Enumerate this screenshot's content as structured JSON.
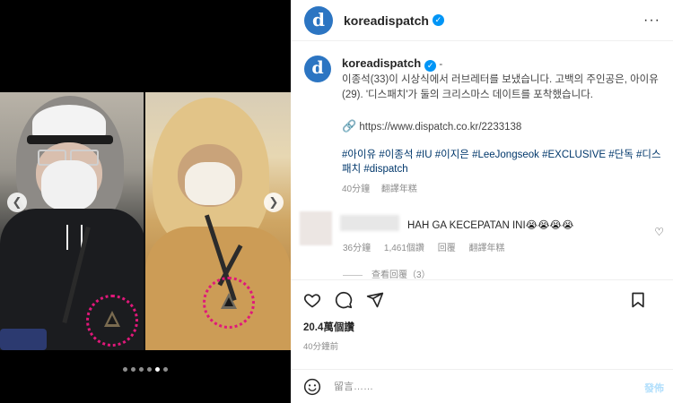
{
  "media": {
    "carousel_total": 6,
    "carousel_active_index": 4,
    "prev_icon": "chevron-left-icon",
    "next_icon": "chevron-right-icon"
  },
  "header": {
    "avatar_letter": "d",
    "username": "koreadispatch",
    "verified_icon": "verified-badge-icon",
    "more_icon": "more-options-icon"
  },
  "caption": {
    "avatar_letter": "d",
    "username": "koreadispatch",
    "separator": " -",
    "text": "이종석(33)이 시상식에서 러브레터를 보냈습니다. 고백의 주인공은, 아이유(29). '디스패치'가 둘의 크리스마스 데이트를 포착했습니다.",
    "link_icon": "link-icon",
    "link_text": "https://www.dispatch.co.kr/2233138",
    "hashtags": "#아이유 #이종석 #IU #이지은 #LeeJongseok #EXCLUSIVE #단독 #디스패치 #dispatch",
    "time": "40分鐘",
    "translate": "翻譯年糕"
  },
  "comment": {
    "text": "HAH GA KECEPATAN INI😭😭😭😭",
    "time": "36分鐘",
    "likes": "1,461個讚",
    "reply": "回覆",
    "translate": "翻譯年糕",
    "view_replies": "查看回覆（3）",
    "heart_icon": "heart-outline-icon"
  },
  "actions": {
    "like_icon": "heart-icon",
    "comment_icon": "comment-icon",
    "share_icon": "send-icon",
    "save_icon": "bookmark-icon",
    "likes": "20.4萬個讚",
    "posted_ago": "40分鐘前"
  },
  "composer": {
    "emoji_icon": "emoji-icon",
    "placeholder": "留言……",
    "post_label": "發佈"
  },
  "colors": {
    "accent": "#0095f6",
    "brand_avatar": "#2c75c2",
    "circle_mark": "#e0187a"
  }
}
